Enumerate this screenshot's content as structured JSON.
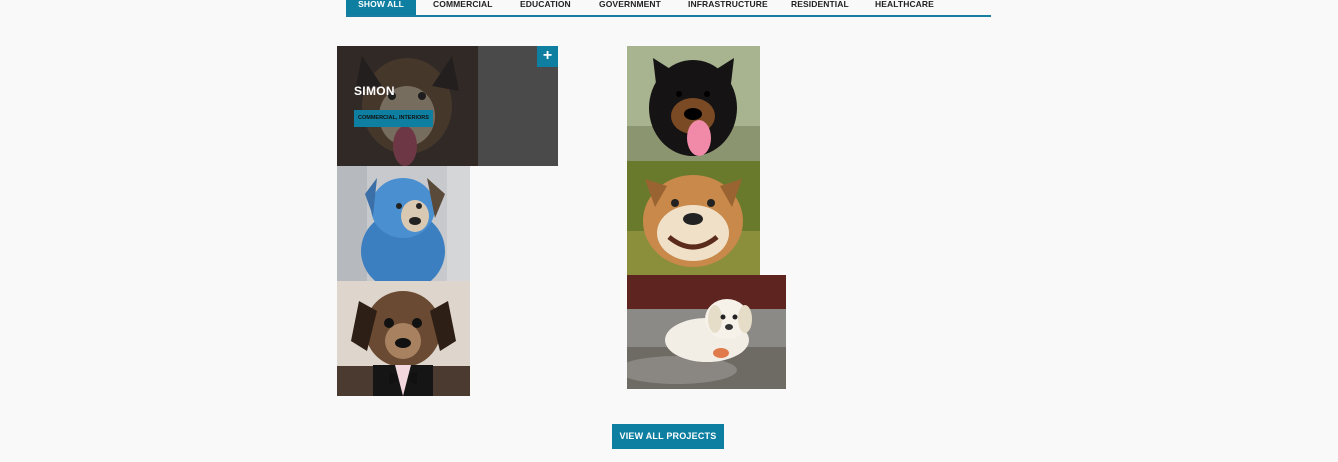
{
  "filters": {
    "tabs": [
      {
        "label": "SHOW ALL"
      },
      {
        "label": "COMMERCIAL"
      },
      {
        "label": "EDUCATION"
      },
      {
        "label": "GOVERNMENT"
      },
      {
        "label": "INFRASTRUCTURE"
      },
      {
        "label": "RESIDENTIAL"
      },
      {
        "label": "HEALTHCARE"
      }
    ],
    "active": "SHOW ALL"
  },
  "featured": {
    "title": "SIMON",
    "tags": "COMMERCIAL, INTERIORS",
    "expand_symbol": "+"
  },
  "footer": {
    "view_all_label": "VIEW ALL PROJECTS"
  },
  "colors": {
    "accent": "#0e7fa0",
    "background": "#f9f9f9",
    "overlay": "#4a4a4a"
  }
}
